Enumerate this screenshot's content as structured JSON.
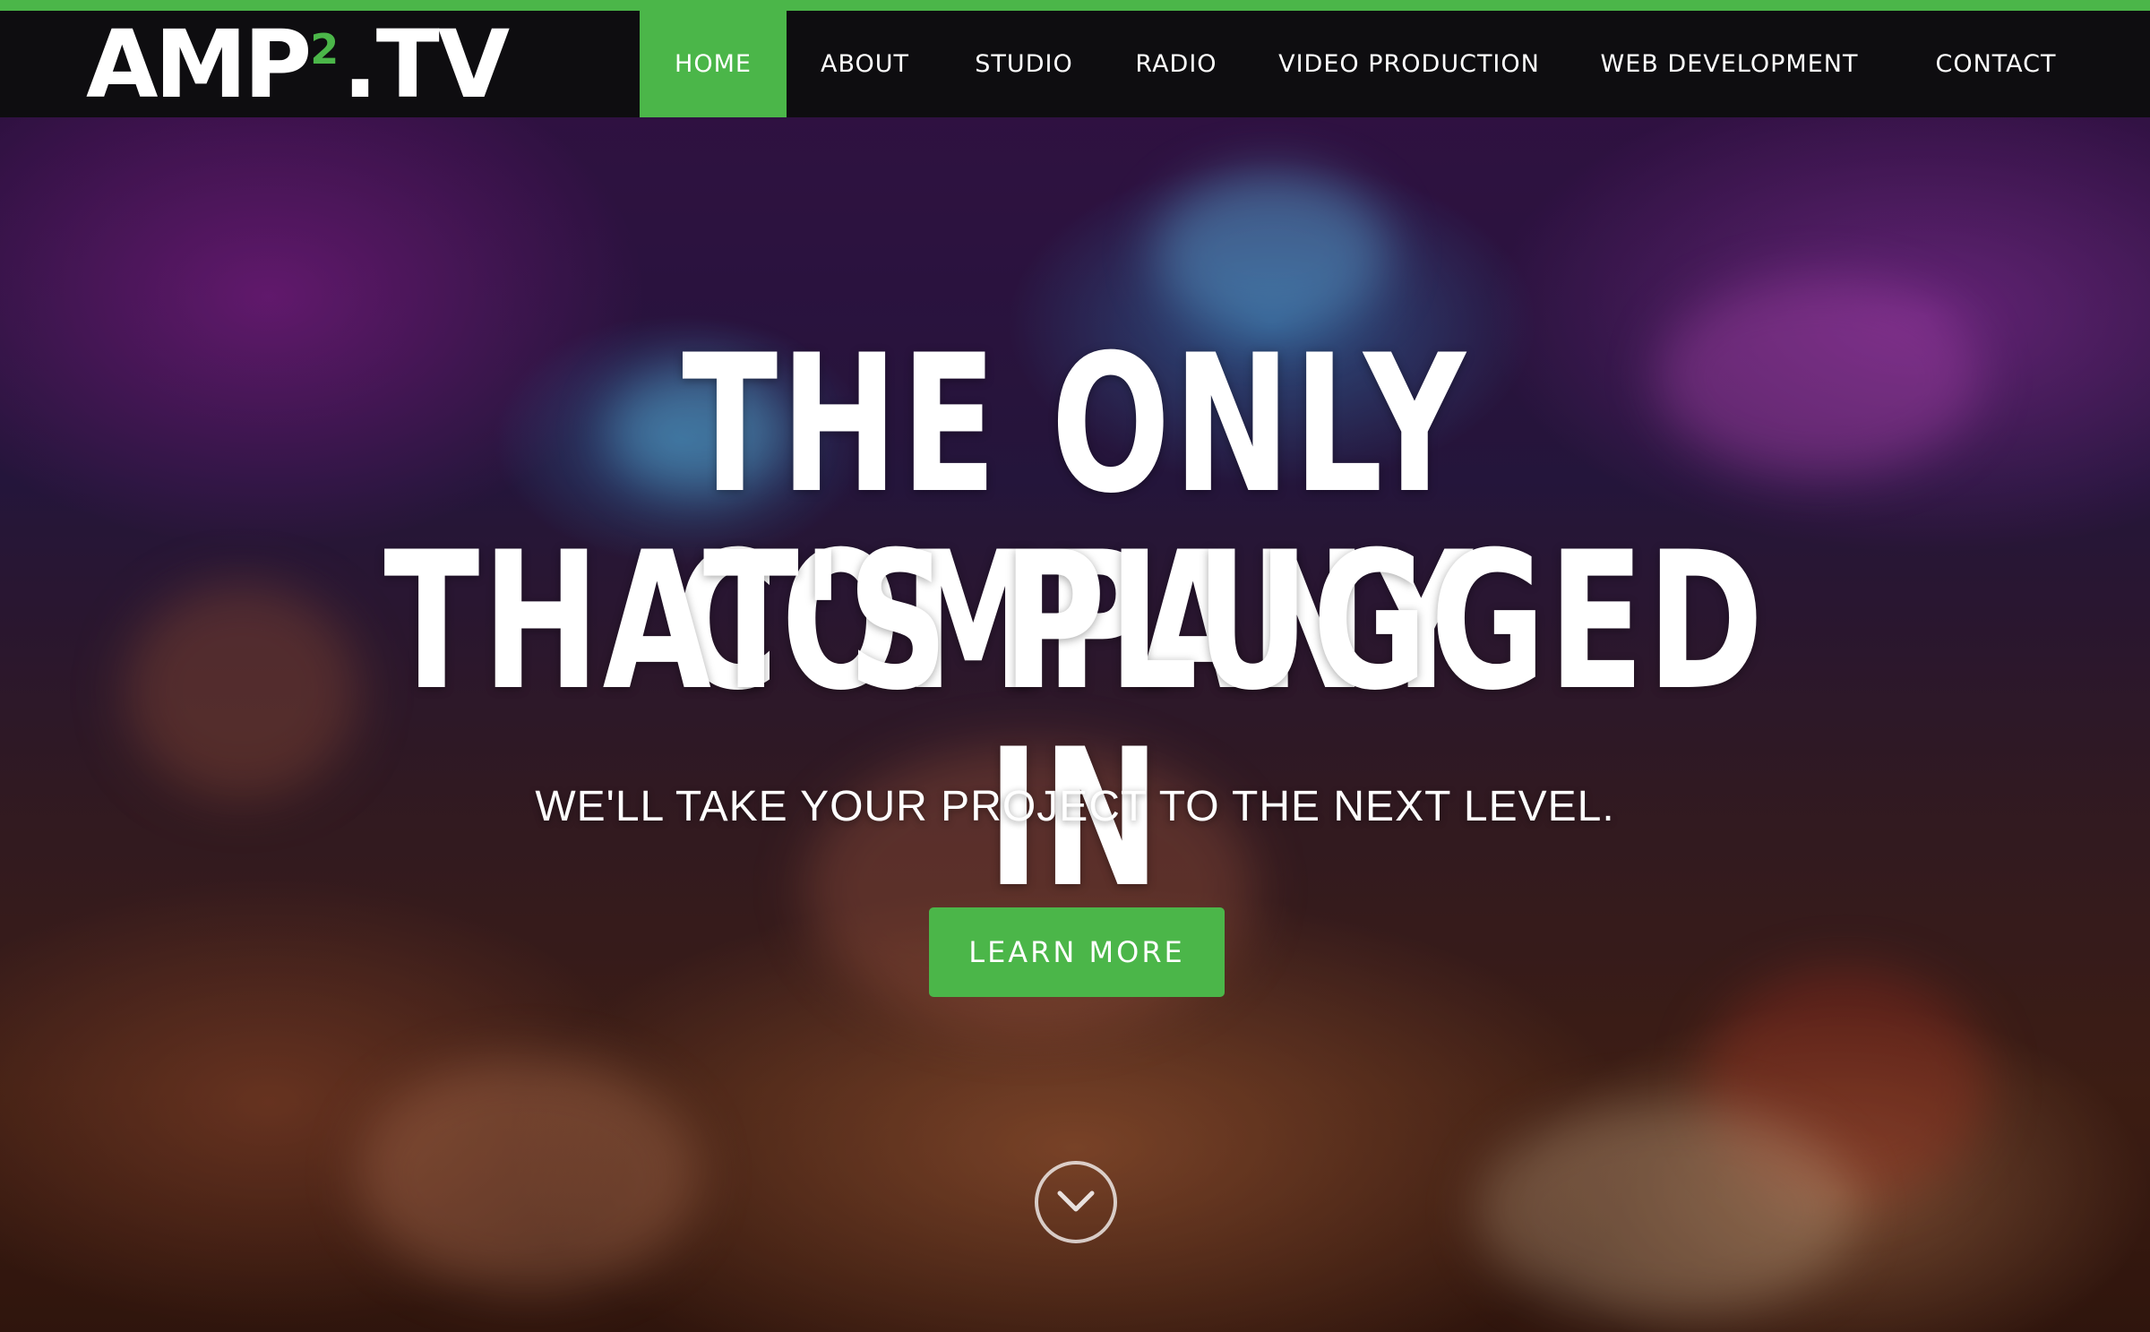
{
  "brand": {
    "logo_main": "AMP",
    "logo_sup": "2",
    "logo_suffix": ".TV",
    "accent_color": "#4bb649"
  },
  "nav": {
    "items": [
      {
        "label": "HOME",
        "active": true
      },
      {
        "label": "ABOUT",
        "active": false
      },
      {
        "label": "STUDIO",
        "active": false
      },
      {
        "label": "RADIO",
        "active": false
      },
      {
        "label": "VIDEO PRODUCTION",
        "active": false
      },
      {
        "label": "WEB DEVELOPMENT",
        "active": false
      },
      {
        "label": "CONTACT",
        "active": false
      }
    ]
  },
  "hero": {
    "headline_line1": "THE ONLY COMPANY",
    "headline_line2": "THAT'S PLUGGED IN",
    "subheadline": "WE'LL TAKE YOUR PROJECT TO THE NEXT LEVEL.",
    "cta_label": "LEARN MORE",
    "scroll_icon": "chevron-down-circle-icon",
    "background": "concert-crowd-photo"
  }
}
